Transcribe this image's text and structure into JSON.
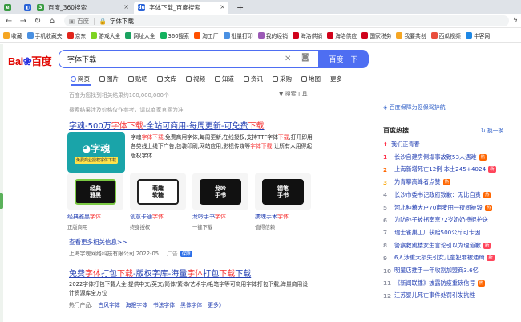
{
  "browser": {
    "tabs": [
      {
        "title": "百度_360搜索",
        "icon": "360-icon",
        "active": false
      },
      {
        "title": "百度一下，你就知道",
        "icon": "baidu-icon",
        "active": false
      },
      {
        "title": "字体下载_百度搜索",
        "icon": "baidu-icon",
        "active": true
      }
    ],
    "new_tab": "+",
    "address": {
      "host_label": "百度",
      "separator": "|",
      "query": "字体下载"
    },
    "bookmarks": [
      {
        "label": "收藏",
        "color": "#f5a623"
      },
      {
        "label": "手机收藏夹",
        "color": "#4a90e2"
      },
      {
        "label": "京东",
        "color": "#e1251b"
      },
      {
        "label": "游戏大全",
        "color": "#7ed321"
      },
      {
        "label": "网址大全",
        "color": "#1aa260"
      },
      {
        "label": "360搜索",
        "color": "#13b15e"
      },
      {
        "label": "淘工厂",
        "color": "#ff5000"
      },
      {
        "label": "批量打印",
        "color": "#4a90e2"
      },
      {
        "label": "我的经销",
        "color": "#9b59b6"
      },
      {
        "label": "海洛供销",
        "color": "#d0021b"
      },
      {
        "label": "海洛供应",
        "color": "#d0021b"
      },
      {
        "label": "国家税务",
        "color": "#d0021b"
      },
      {
        "label": "我要共创",
        "color": "#f5a623"
      },
      {
        "label": "西瓜视频",
        "color": "#e94e3c"
      },
      {
        "label": "牛客网",
        "color": "#1e88e5"
      }
    ]
  },
  "search": {
    "logo_text": "Bai",
    "logo_paw": "du",
    "logo_cn": "百度",
    "query": "字体下载",
    "button_label": "百度一下",
    "tabs": [
      "网页",
      "图片",
      "贴吧",
      "文库",
      "视频",
      "知道",
      "资讯",
      "采购",
      "地图",
      "更多"
    ],
    "hint": "百度为您找到相关结果约100,000,000个",
    "tools": "搜索工具",
    "privacy": "搜索结果涉及价格仅作参考，请以商家官网为准",
    "protect": "百度保障为您保驾护航"
  },
  "result1": {
    "title_pre": "字魂-500万",
    "title_em": "字体下载",
    "title_mid": "-全站可商用-每周更新-可免费",
    "title_em2": "下载",
    "img_big": "字魂",
    "img_small": "免费商业授权字体下载",
    "desc_pre": "字魂",
    "desc_em": "字体下载",
    "desc_body": ",免费商用字体,每周更新,在线授权,支持TTF字体",
    "desc_em2": "下载",
    "desc_body2": ",打开即用 各类线上线下广告,包装印刷,网站应用,影视传媒等",
    "desc_em3": "字体下载",
    "desc_body3": ",让所有人用得起版权字体",
    "thumbs": [
      {
        "art": "经典\n雅黑",
        "cap_pre": "经典雅黑",
        "cap_em": "字体",
        "sub": "正版商用"
      },
      {
        "art": "萌趣\n软糖",
        "cap_pre": "创意卡通",
        "cap_em": "字体",
        "sub": "终身授权"
      },
      {
        "art": "龙吟\n手书",
        "cap_pre": "龙吟手书",
        "cap_em": "字体",
        "sub": "一键下载"
      },
      {
        "art": "钢笔\n手书",
        "cap_pre": "携魂手术",
        "cap_em": "字体",
        "sub": "值得信赖"
      }
    ],
    "more": "查看更多相关信息>>",
    "source": "上海字魂网络科技有限公司 2022-05",
    "ad": "广告",
    "bao": "保障"
  },
  "result2": {
    "title_pre": "免费",
    "title_em": "字体",
    "title_mid": "打包",
    "title_em2": "下载",
    "title_rest": "-版权字库-海量",
    "title_em3": "字体",
    "title_mid2": "打包",
    "title_em4": "下载",
    "title_end": "下载",
    "desc": "2022字体打包下载大全,提供中文/英文/简体/繁体/艺术字/毛笔字等可商用字体打包下载,海量商用设计资源库全方位",
    "links_label": "热门产品:",
    "links": [
      "古风字体",
      "海报字体",
      "书法字体",
      "黑体字体",
      "更多》"
    ]
  },
  "hot": {
    "title": "百度热搜",
    "switch": "换一换",
    "items": [
      {
        "rank": "",
        "text": "我们正青春",
        "badge": "",
        "pinned": true
      },
      {
        "rank": "1",
        "text": "长沙自建房倒塌事故致53人遇难",
        "badge": "热"
      },
      {
        "rank": "2",
        "text": "上海新增死亡12例 本土245+4024",
        "badge": "新"
      },
      {
        "rank": "3",
        "text": "为青攀高峰者点赞",
        "badge": "热"
      },
      {
        "rank": "4",
        "text": "长沙市委书记政府致歉：无比自责",
        "badge": "热"
      },
      {
        "rank": "5",
        "text": "河北种粮大户70亩麦田一夜间被毁",
        "badge": "热"
      },
      {
        "rank": "6",
        "text": "为防孙子被拐南京72岁奶奶持棍护送",
        "badge": ""
      },
      {
        "rank": "7",
        "text": "瑞士雀巢工厂获赔500公斤可卡因",
        "badge": ""
      },
      {
        "rank": "8",
        "text": "警察救跳楼女生言论引以为理道歉",
        "badge": "新"
      },
      {
        "rank": "9",
        "text": "6人涉重大损失引女儿童犯罪被通缉",
        "badge": "新"
      },
      {
        "rank": "10",
        "text": "明星店推手一年收割加盟商3.6亿",
        "badge": ""
      },
      {
        "rank": "11",
        "text": "《新闻联播》披露防疫重磅信号",
        "badge": "热"
      },
      {
        "rank": "12",
        "text": "江苏婴儿死亡事件处罚引发抗性",
        "badge": ""
      }
    ]
  }
}
